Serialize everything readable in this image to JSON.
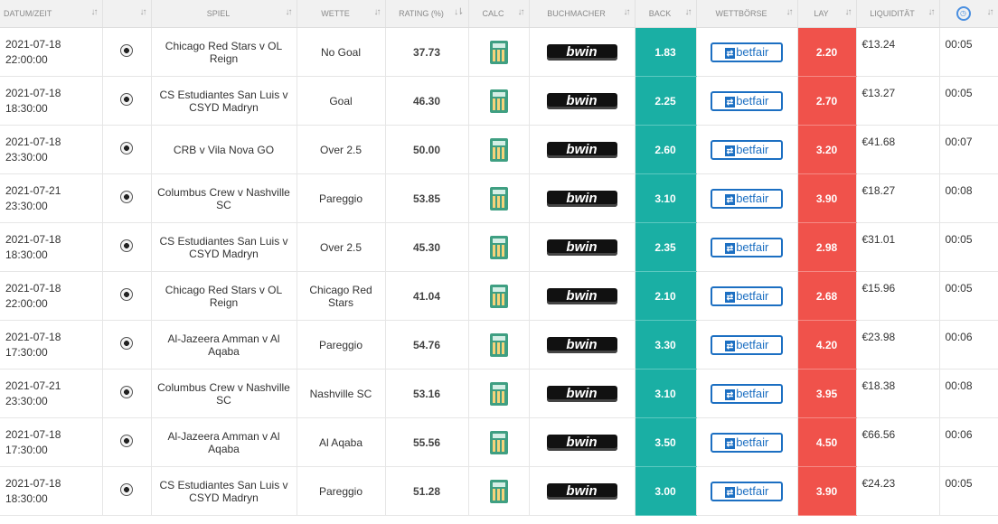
{
  "headers": {
    "datum": "DATUM/ZEIT",
    "spiel": "SPIEL",
    "wette": "WETTE",
    "rating": "RATING (%)",
    "calc": "CALC",
    "buchmacher": "BUCHMACHER",
    "back": "BACK",
    "wettboerse": "WETTBÖRSE",
    "lay": "LAY",
    "liquiditaet": "LIQUIDITÄT"
  },
  "icons": {
    "sort": "sort-arrows-icon",
    "clock": "clock-icon",
    "sport": "soccer-ball-icon",
    "calc": "calculator-icon"
  },
  "brands": {
    "bookmaker": "bwin",
    "exchange": "betfair"
  },
  "colors": {
    "back": "#1aafa4",
    "lay": "#f0524b",
    "betfair": "#1c6fc2"
  },
  "rows": [
    {
      "date": "2021-07-18",
      "time": "22:00:00",
      "match": "Chicago Red Stars v OL Reign",
      "bet": "No Goal",
      "rating": "37.73",
      "back": "1.83",
      "lay": "2.20",
      "liquidity": "€13.24",
      "countdown": "00:05"
    },
    {
      "date": "2021-07-18",
      "time": "18:30:00",
      "match": "CS Estudiantes San Luis v CSYD Madryn",
      "bet": "Goal",
      "rating": "46.30",
      "back": "2.25",
      "lay": "2.70",
      "liquidity": "€13.27",
      "countdown": "00:05"
    },
    {
      "date": "2021-07-18",
      "time": "23:30:00",
      "match": "CRB v Vila Nova GO",
      "bet": "Over 2.5",
      "rating": "50.00",
      "back": "2.60",
      "lay": "3.20",
      "liquidity": "€41.68",
      "countdown": "00:07"
    },
    {
      "date": "2021-07-21",
      "time": "23:30:00",
      "match": "Columbus Crew v Nashville SC",
      "bet": "Pareggio",
      "rating": "53.85",
      "back": "3.10",
      "lay": "3.90",
      "liquidity": "€18.27",
      "countdown": "00:08"
    },
    {
      "date": "2021-07-18",
      "time": "18:30:00",
      "match": "CS Estudiantes San Luis v CSYD Madryn",
      "bet": "Over 2.5",
      "rating": "45.30",
      "back": "2.35",
      "lay": "2.98",
      "liquidity": "€31.01",
      "countdown": "00:05"
    },
    {
      "date": "2021-07-18",
      "time": "22:00:00",
      "match": "Chicago Red Stars v OL Reign",
      "bet": "Chicago Red Stars",
      "rating": "41.04",
      "back": "2.10",
      "lay": "2.68",
      "liquidity": "€15.96",
      "countdown": "00:05"
    },
    {
      "date": "2021-07-18",
      "time": "17:30:00",
      "match": "Al-Jazeera Amman v Al Aqaba",
      "bet": "Pareggio",
      "rating": "54.76",
      "back": "3.30",
      "lay": "4.20",
      "liquidity": "€23.98",
      "countdown": "00:06"
    },
    {
      "date": "2021-07-21",
      "time": "23:30:00",
      "match": "Columbus Crew v Nashville SC",
      "bet": "Nashville SC",
      "rating": "53.16",
      "back": "3.10",
      "lay": "3.95",
      "liquidity": "€18.38",
      "countdown": "00:08"
    },
    {
      "date": "2021-07-18",
      "time": "17:30:00",
      "match": "Al-Jazeera Amman v Al Aqaba",
      "bet": "Al Aqaba",
      "rating": "55.56",
      "back": "3.50",
      "lay": "4.50",
      "liquidity": "€66.56",
      "countdown": "00:06"
    },
    {
      "date": "2021-07-18",
      "time": "18:30:00",
      "match": "CS Estudiantes San Luis v CSYD Madryn",
      "bet": "Pareggio",
      "rating": "51.28",
      "back": "3.00",
      "lay": "3.90",
      "liquidity": "€24.23",
      "countdown": "00:05"
    }
  ]
}
